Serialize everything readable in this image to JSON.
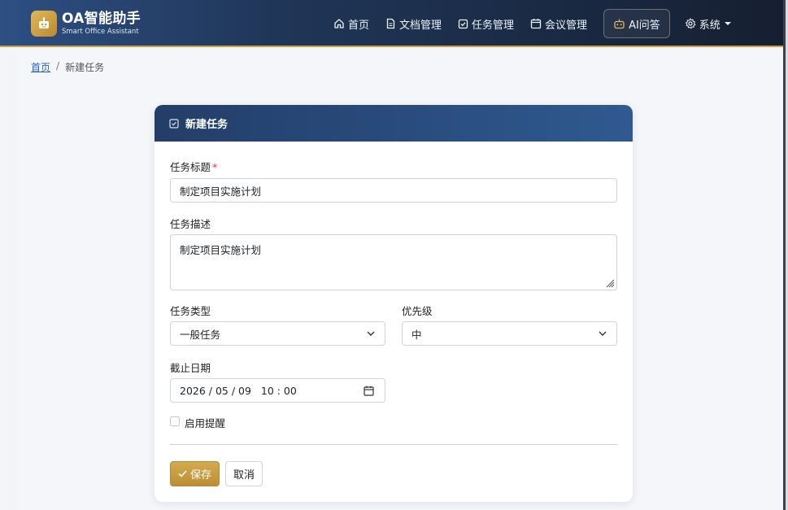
{
  "brand": {
    "title": "OA智能助手",
    "subtitle": "Smart Office Assistant",
    "accent": "#c9a14a"
  },
  "nav": {
    "items": [
      {
        "label": "首页",
        "icon": "home-icon"
      },
      {
        "label": "文档管理",
        "icon": "document-icon"
      },
      {
        "label": "任务管理",
        "icon": "checkbox-icon"
      },
      {
        "label": "会议管理",
        "icon": "calendar-icon"
      },
      {
        "label": "AI问答",
        "icon": "robot-icon"
      },
      {
        "label": "系统",
        "icon": "gear-icon"
      }
    ]
  },
  "breadcrumb": {
    "home": "首页",
    "separator": "/",
    "current": "新建任务"
  },
  "form": {
    "header_title": "新建任务",
    "title_label": "任务标题",
    "required_mark": "*",
    "title_value": "制定项目实施计划",
    "desc_label": "任务描述",
    "desc_value": "制定项目实施计划",
    "type_label": "任务类型",
    "type_value": "一般任务",
    "priority_label": "优先级",
    "priority_value": "中",
    "deadline_label": "截止日期",
    "deadline_value": "2026 / 05 / 09   10 : 00",
    "reminder_label": "启用提醒",
    "reminder_checked": false,
    "save_label": "保存",
    "cancel_label": "取消"
  }
}
